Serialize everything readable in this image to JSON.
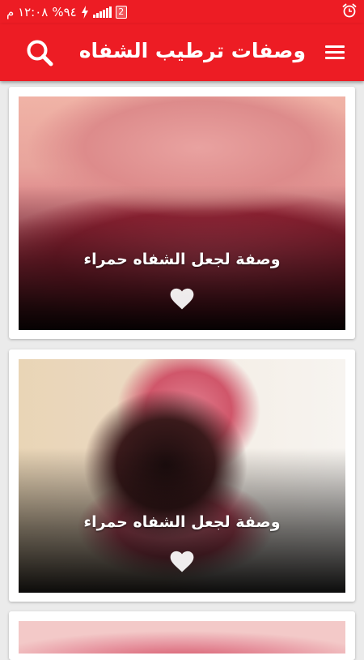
{
  "status_bar": {
    "time": "١٢:٠٨ م",
    "battery": "%٩٤",
    "sim_label": "2",
    "icons": [
      "alarm-icon",
      "sim-icon",
      "signal-icon",
      "battery-charging-icon"
    ]
  },
  "toolbar": {
    "title": "وصفات ترطيب الشفاه",
    "search_icon": "search-icon",
    "menu_icon": "menu-icon"
  },
  "cards": [
    {
      "caption": "وصفة لجعل الشفاه حمراء",
      "favorite_icon": "heart-icon"
    },
    {
      "caption": "وصفة لجعل الشفاه حمراء",
      "favorite_icon": "heart-icon"
    }
  ],
  "colors": {
    "primary": "#ed1c24",
    "background": "#ebebeb",
    "card": "#ffffff"
  }
}
